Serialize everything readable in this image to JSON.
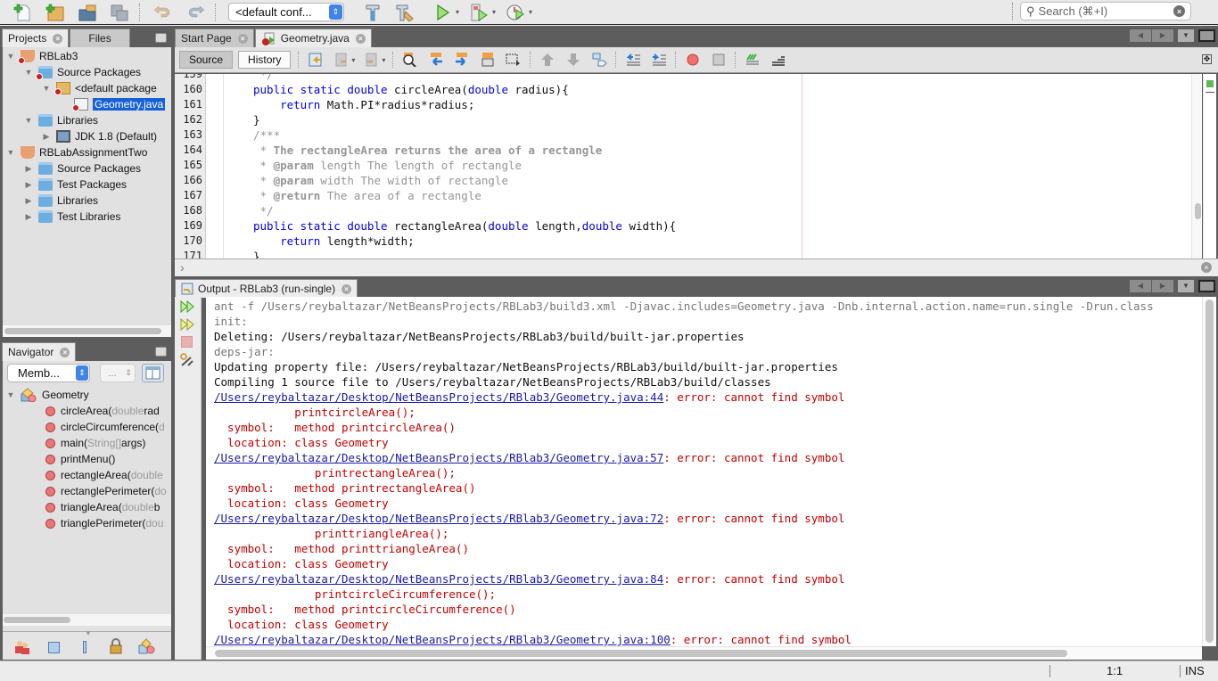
{
  "toolbar": {
    "config_select": "<default conf...",
    "search_placeholder": "Search (⌘+I)",
    "buttons": [
      "new-file",
      "new-project",
      "open-project",
      "save-all",
      "undo",
      "redo",
      "build",
      "clean-build",
      "run",
      "debug",
      "profile"
    ]
  },
  "projects_panel": {
    "tabs": [
      {
        "label": "Projects"
      },
      {
        "label": "Files"
      }
    ],
    "tree": [
      {
        "label": "RBLab3",
        "level": 0,
        "expanded": true,
        "kind": "project",
        "error": true
      },
      {
        "label": "Source Packages",
        "level": 1,
        "expanded": true,
        "kind": "folder",
        "error": true
      },
      {
        "label": "<default package",
        "level": 2,
        "expanded": true,
        "kind": "package",
        "error": true
      },
      {
        "label": "Geometry.java",
        "level": 3,
        "kind": "java-file",
        "error": true,
        "selected": true
      },
      {
        "label": "Libraries",
        "level": 1,
        "expanded": true,
        "kind": "library"
      },
      {
        "label": "JDK 1.8 (Default)",
        "level": 2,
        "expanded": false,
        "kind": "jdk"
      },
      {
        "label": "RBLabAssignmentTwo",
        "level": 0,
        "expanded": true,
        "kind": "project"
      },
      {
        "label": "Source Packages",
        "level": 1,
        "expanded": false,
        "kind": "folder"
      },
      {
        "label": "Test Packages",
        "level": 1,
        "expanded": false,
        "kind": "folder"
      },
      {
        "label": "Libraries",
        "level": 1,
        "expanded": false,
        "kind": "library"
      },
      {
        "label": "Test Libraries",
        "level": 1,
        "expanded": false,
        "kind": "library"
      }
    ]
  },
  "navigator": {
    "title": "Navigator",
    "filter_select": "Memb...",
    "secondary_select": "...",
    "class_name": "Geometry",
    "members": [
      {
        "name": "circleArea(",
        "params": "double",
        "rest": " rad"
      },
      {
        "name": "circleCircumference(",
        "params": "d",
        "rest": ""
      },
      {
        "name": "main(",
        "params": "String[]",
        "rest": " args)"
      },
      {
        "name": "printMenu()",
        "params": "",
        "rest": ""
      },
      {
        "name": "rectangleArea(",
        "params": "double",
        "rest": ""
      },
      {
        "name": "rectanglePerimeter(",
        "params": "do",
        "rest": ""
      },
      {
        "name": "triangleArea(",
        "params": "double",
        "rest": " b"
      },
      {
        "name": "trianglePerimeter(",
        "params": "dou",
        "rest": ""
      }
    ]
  },
  "editor": {
    "tabs": [
      {
        "label": "Start Page"
      },
      {
        "label": "Geometry.java",
        "active": true
      }
    ],
    "view_buttons": {
      "source": "Source",
      "history": "History"
    },
    "lines": [
      {
        "n": "159",
        "parts": [
          {
            "t": " */",
            "c": "cm"
          }
        ]
      },
      {
        "n": "160",
        "parts": [
          {
            "t": "public static double",
            "c": "kw"
          },
          {
            "t": " circleArea(",
            "c": ""
          },
          {
            "t": "double",
            "c": "kw"
          },
          {
            "t": " radius){",
            "c": ""
          }
        ]
      },
      {
        "n": "161",
        "parts": [
          {
            "t": "    return",
            "c": "kw"
          },
          {
            "t": " Math.PI*radius*radius;",
            "c": ""
          }
        ]
      },
      {
        "n": "162",
        "parts": [
          {
            "t": "}",
            "c": ""
          }
        ]
      },
      {
        "n": "163",
        "parts": [
          {
            "t": "/***",
            "c": "cm"
          }
        ]
      },
      {
        "n": "164",
        "parts": [
          {
            "t": " * ",
            "c": "cm"
          },
          {
            "t": "The rectangleArea returns the area of a rectangle",
            "c": "cmb"
          }
        ]
      },
      {
        "n": "165",
        "parts": [
          {
            "t": " * ",
            "c": "cm"
          },
          {
            "t": "@param",
            "c": "cmb"
          },
          {
            "t": " length The length of rectangle",
            "c": "cm"
          }
        ]
      },
      {
        "n": "166",
        "parts": [
          {
            "t": " * ",
            "c": "cm"
          },
          {
            "t": "@param",
            "c": "cmb"
          },
          {
            "t": " width The width of rectangle",
            "c": "cm"
          }
        ]
      },
      {
        "n": "167",
        "parts": [
          {
            "t": " * ",
            "c": "cm"
          },
          {
            "t": "@return",
            "c": "cmb"
          },
          {
            "t": " The area of a rectangle",
            "c": "cm"
          }
        ]
      },
      {
        "n": "168",
        "parts": [
          {
            "t": " */",
            "c": "cm"
          }
        ]
      },
      {
        "n": "169",
        "parts": [
          {
            "t": "public static double",
            "c": "kw"
          },
          {
            "t": " rectangleArea(",
            "c": ""
          },
          {
            "t": "double",
            "c": "kw"
          },
          {
            "t": " length,",
            "c": ""
          },
          {
            "t": "double",
            "c": "kw"
          },
          {
            "t": " width){",
            "c": ""
          }
        ]
      },
      {
        "n": "170",
        "parts": [
          {
            "t": "    return",
            "c": "kw"
          },
          {
            "t": " length*width;",
            "c": ""
          }
        ]
      },
      {
        "n": "171",
        "parts": [
          {
            "t": "}",
            "c": ""
          }
        ]
      }
    ]
  },
  "output": {
    "tab_label": "Output - RBLab3 (run-single)",
    "lines": [
      {
        "parts": [
          {
            "t": "ant -f /Users/reybaltazar/NetBeansProjects/RBLab3/build3.xml -Djavac.includes=Geometry.java -Dnb.internal.action.name=run.single -Drun.class",
            "c": "o-gray"
          }
        ]
      },
      {
        "parts": [
          {
            "t": "init:",
            "c": "o-gray"
          }
        ]
      },
      {
        "parts": [
          {
            "t": "Deleting: /Users/reybaltazar/NetBeansProjects/RBLab3/build/built-jar.properties",
            "c": "o-black"
          }
        ]
      },
      {
        "parts": [
          {
            "t": "deps-jar:",
            "c": "o-gray"
          }
        ]
      },
      {
        "parts": [
          {
            "t": "Updating property file: /Users/reybaltazar/NetBeansProjects/RBLab3/build/built-jar.properties",
            "c": "o-black"
          }
        ]
      },
      {
        "parts": [
          {
            "t": "Compiling 1 source file to /Users/reybaltazar/NetBeansProjects/RBLab3/build/classes",
            "c": "o-black"
          }
        ]
      },
      {
        "parts": [
          {
            "t": "/Users/reybaltazar/Desktop/NetBeansProjects/RBlab3/Geometry.java:44",
            "c": "o-link"
          },
          {
            "t": ": error: cannot find symbol",
            "c": "o-red"
          }
        ]
      },
      {
        "parts": [
          {
            "t": "            printcircleArea();",
            "c": "o-red"
          }
        ]
      },
      {
        "parts": [
          {
            "t": "  symbol:   method printcircleArea()",
            "c": "o-red"
          }
        ]
      },
      {
        "parts": [
          {
            "t": "  location: class Geometry",
            "c": "o-red"
          }
        ]
      },
      {
        "parts": [
          {
            "t": "/Users/reybaltazar/Desktop/NetBeansProjects/RBlab3/Geometry.java:57",
            "c": "o-link"
          },
          {
            "t": ": error: cannot find symbol",
            "c": "o-red"
          }
        ]
      },
      {
        "parts": [
          {
            "t": "               printrectangleArea();",
            "c": "o-red"
          }
        ]
      },
      {
        "parts": [
          {
            "t": "  symbol:   method printrectangleArea()",
            "c": "o-red"
          }
        ]
      },
      {
        "parts": [
          {
            "t": "  location: class Geometry",
            "c": "o-red"
          }
        ]
      },
      {
        "parts": [
          {
            "t": "/Users/reybaltazar/Desktop/NetBeansProjects/RBlab3/Geometry.java:72",
            "c": "o-link"
          },
          {
            "t": ": error: cannot find symbol",
            "c": "o-red"
          }
        ]
      },
      {
        "parts": [
          {
            "t": "               printtriangleArea();",
            "c": "o-red"
          }
        ]
      },
      {
        "parts": [
          {
            "t": "  symbol:   method printtriangleArea()",
            "c": "o-red"
          }
        ]
      },
      {
        "parts": [
          {
            "t": "  location: class Geometry",
            "c": "o-red"
          }
        ]
      },
      {
        "parts": [
          {
            "t": "/Users/reybaltazar/Desktop/NetBeansProjects/RBlab3/Geometry.java:84",
            "c": "o-link"
          },
          {
            "t": ": error: cannot find symbol",
            "c": "o-red"
          }
        ]
      },
      {
        "parts": [
          {
            "t": "               printcircleCircumference();",
            "c": "o-red"
          }
        ]
      },
      {
        "parts": [
          {
            "t": "  symbol:   method printcircleCircumference()",
            "c": "o-red"
          }
        ]
      },
      {
        "parts": [
          {
            "t": "  location: class Geometry",
            "c": "o-red"
          }
        ]
      },
      {
        "parts": [
          {
            "t": "/Users/reybaltazar/Desktop/NetBeansProjects/RBlab3/Geometry.java:100",
            "c": "o-link"
          },
          {
            "t": ": error: cannot find symbol",
            "c": "o-red"
          }
        ]
      }
    ]
  },
  "status_bar": {
    "position": "1:1",
    "mode": "INS"
  },
  "colors": {
    "selection": "#1660d8",
    "keyword": "#0000e6",
    "error": "#c40000",
    "link": "#1a1aa6"
  }
}
